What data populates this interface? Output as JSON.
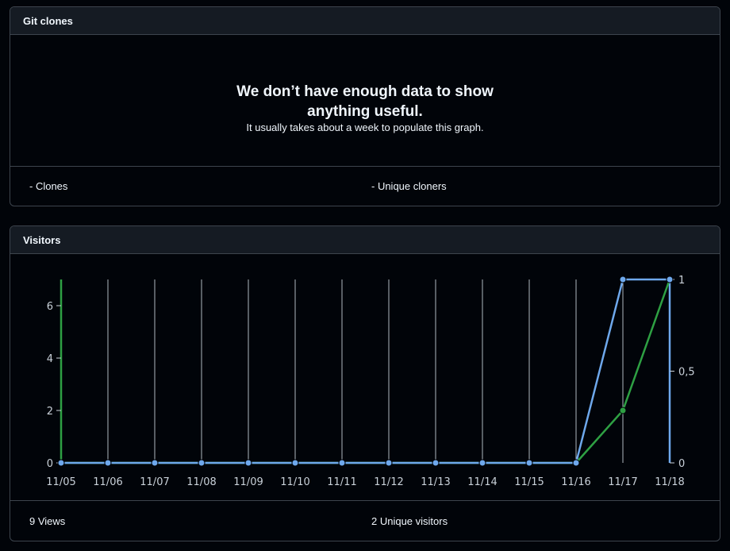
{
  "clones": {
    "title": "Git clones",
    "empty_title": "We don’t have enough data to show anything useful.",
    "empty_subtitle": "It usually takes about a week to populate this graph.",
    "legend_clones": "- Clones",
    "legend_unique": "- Unique cloners"
  },
  "visitors": {
    "title": "Visitors",
    "views_label": "9 Views",
    "unique_label": "2 Unique visitors"
  },
  "colors": {
    "views": "#2ea043",
    "unique": "#6ea8ec",
    "grid": "#b0b7bf",
    "tick": "#c9d1d9"
  },
  "chart_data": {
    "type": "line",
    "x": [
      "11/05",
      "11/06",
      "11/07",
      "11/08",
      "11/09",
      "11/10",
      "11/11",
      "11/12",
      "11/13",
      "11/14",
      "11/15",
      "11/16",
      "11/17",
      "11/18"
    ],
    "series": [
      {
        "name": "Views",
        "axis": "left",
        "values": [
          0,
          0,
          0,
          0,
          0,
          0,
          0,
          0,
          0,
          0,
          0,
          0,
          2,
          7
        ]
      },
      {
        "name": "Unique visitors",
        "axis": "right",
        "values": [
          0,
          0,
          0,
          0,
          0,
          0,
          0,
          0,
          0,
          0,
          0,
          0,
          1,
          1
        ]
      }
    ],
    "y_left_ticks": [
      "0",
      "2",
      "4",
      "6"
    ],
    "y_left_lim": [
      0,
      7
    ],
    "y_right_ticks": [
      "0",
      "0,5",
      "1"
    ],
    "y_right_lim": [
      0,
      1
    ],
    "grid": "vertical"
  }
}
